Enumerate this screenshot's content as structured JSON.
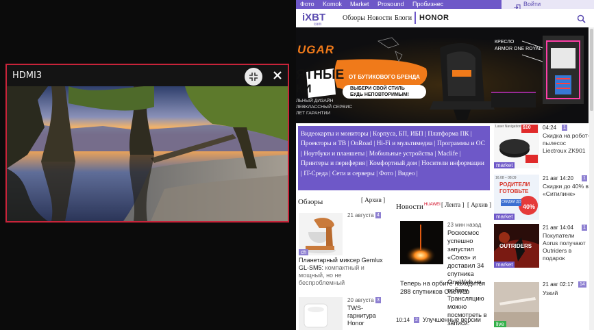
{
  "pip": {
    "title": "HDMI3"
  },
  "browser": {
    "topnav": [
      "Фото",
      "Komok",
      "Market",
      "Prosound",
      "Пробизнес"
    ],
    "login": "Войти",
    "logo": {
      "main": "iXBT",
      "sub": "com"
    },
    "mainnav": [
      "Обзоры",
      "Новости",
      "Блоги"
    ],
    "honor": "HONOR",
    "banner": {
      "brand": "UGAR",
      "chair_line1": "КРЕСЛО",
      "chair_line2": "ARMOR ONE ROYAL",
      "left_big": "ЯТНЫЕ",
      "left_big2": "КИ",
      "bubble": "ОТ БУТИКОВОГО БРЕНДА",
      "cta1": "ВЫБЕРИ СВОЙ СТИЛЬ",
      "cta2": "БУДЬ НЕПОВТОРИМЫМ!",
      "feat1": "ЛЬНЫЙ ДИЗАЙН",
      "feat2": "ЛЕВКЛАССНЫЙ СЕРВИС",
      "feat3": "ЛЕТ ГАРАНТИИ"
    },
    "categories": [
      "Видеокарты и мониторы",
      "Корпуса, БП, ИБП",
      "Платформа ПК",
      "Проекторы и ТВ",
      "OnRoad",
      "Hi-Fi и мультимедиа",
      "Программы и ОС",
      "Ноутбуки и планшеты",
      "Мобильные устройства",
      "Maclife",
      "Принтеры и периферия",
      "Комфортный дом",
      "Носители информации",
      "IT-Среда",
      "Сети и серверы",
      "Фото",
      "Видео"
    ],
    "reviews": {
      "title": "Обзоры",
      "archive": "[ Архив ]",
      "items": [
        {
          "date": "21 августа",
          "count": "4",
          "tag": "ch",
          "title": "Планетарный миксер Gemlux GL-SM5:",
          "sub": "компактный и мощный, но не беспроблемный"
        },
        {
          "date": "20 августа",
          "count": "3",
          "title": "TWS-гарнитура Honor"
        }
      ]
    },
    "news": {
      "title": "Новости",
      "partner": "HUAWEI",
      "feed": "[ Лента ]",
      "archive": "[ Архив ]",
      "items": [
        {
          "time": "23 мин назад",
          "title": "Роскосмос успешно запустил «Союз» и доставил 34 спутника OneWeb на орбиту. Трансляцию можно посмотреть в записи:",
          "sub": "Теперь на орбите находится 288 спутников OneWeb"
        },
        {
          "time": "10:14",
          "count": "2",
          "title": "Улучшенные версии"
        }
      ]
    },
    "right_col": [
      {
        "time": "04:24",
        "count": "1",
        "label": "market",
        "text": "Скидка на робот-пылесос Liectroux ZK901",
        "promo": "$10",
        "promo2": "Laser Navigation"
      },
      {
        "time": "21 авг 14:20",
        "count": "1",
        "label": "market",
        "text": "Скидки до 40% в «Ситилинк»",
        "promo": "РОДИТЕЛИ",
        "promo2": "ГОТОВЬТЕ",
        "promo3": "СКИДКИ ДО",
        "promo4": "40%",
        "promo5": "16.08 – 08.09"
      },
      {
        "time": "21 авг 14:04",
        "count": "1",
        "label": "market",
        "text": "Покупатели Aorus получают Outriders в подарок",
        "promo": "OUTRIDERS"
      },
      {
        "time": "21 авг 02:17",
        "count": "14",
        "label": "live",
        "text": "Узкий"
      }
    ]
  },
  "colors": {
    "accent": "#6e58c8",
    "pip_border": "#c8243a"
  }
}
